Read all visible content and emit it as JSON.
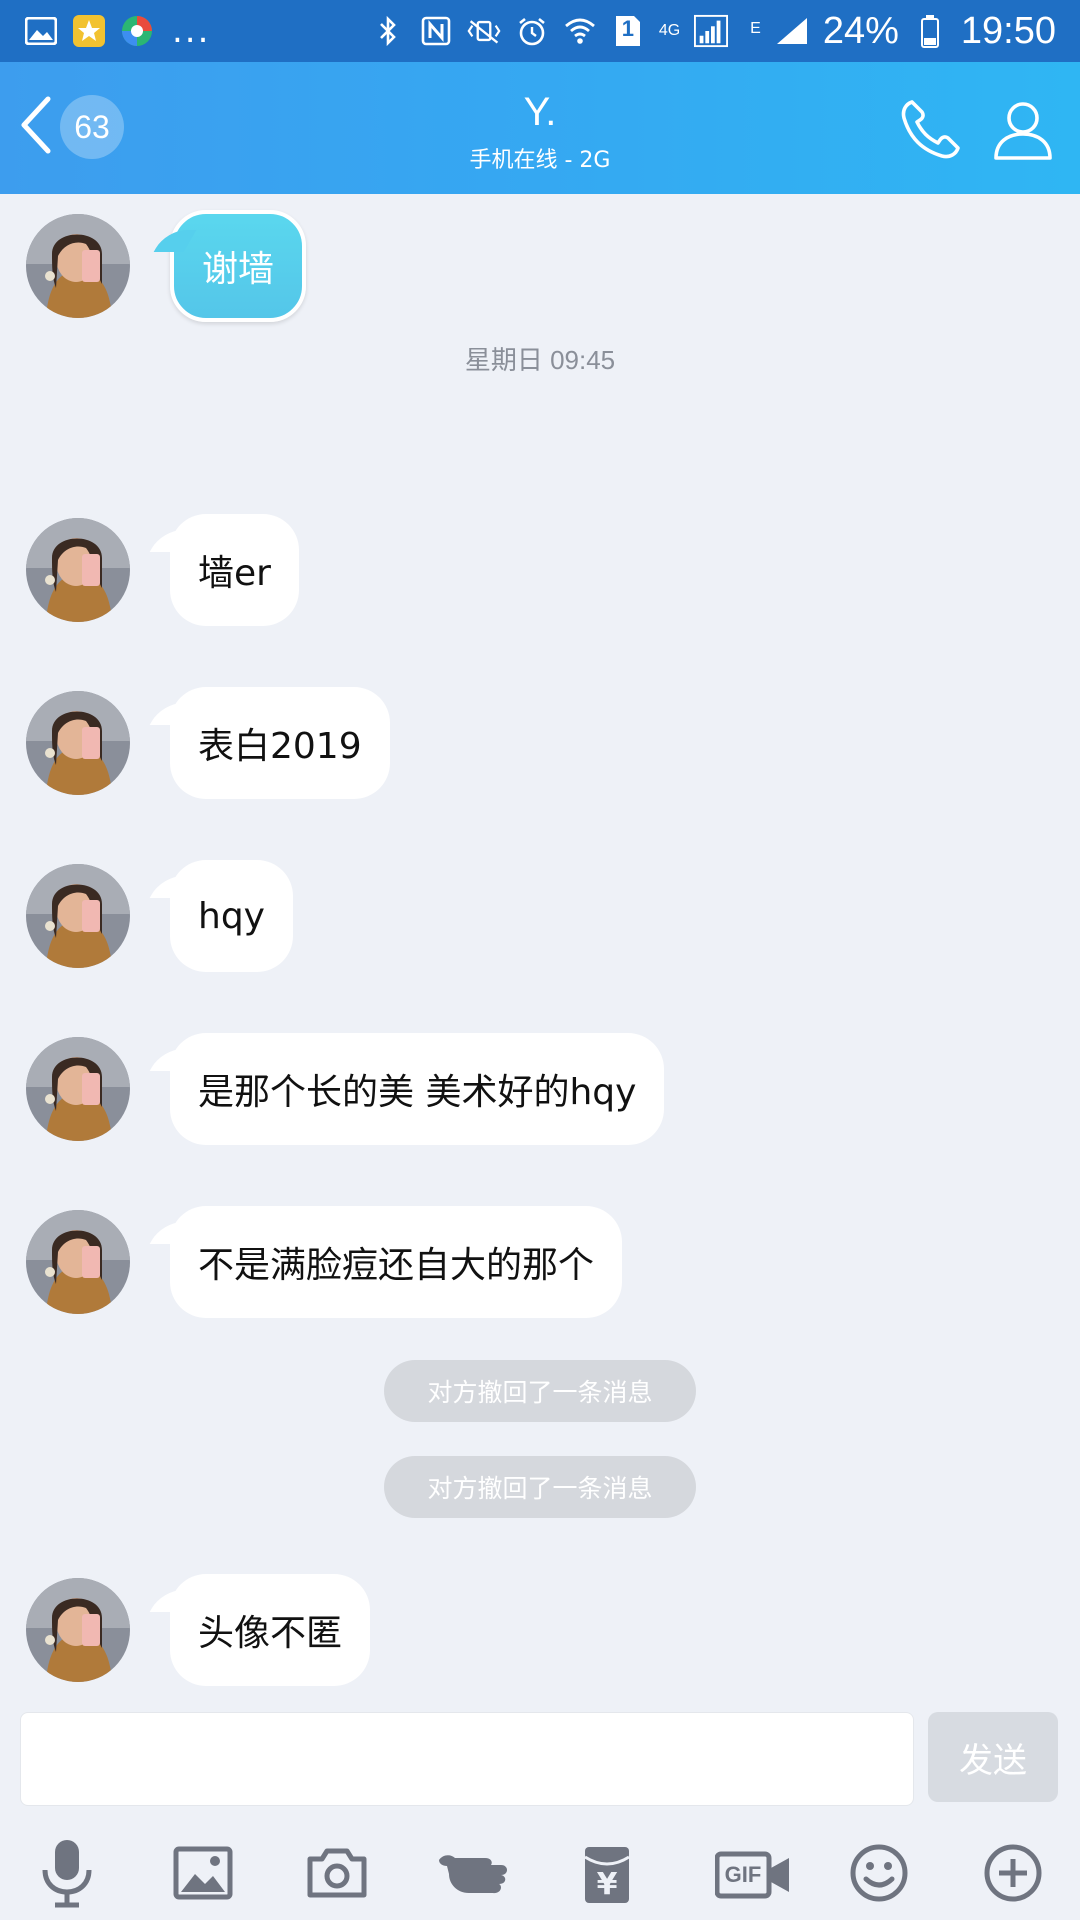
{
  "status_bar": {
    "battery": "24%",
    "time": "19:50",
    "sim_number": "1",
    "network_4g": "4G",
    "network_e": "E",
    "overflow": "..."
  },
  "header": {
    "unread_count": "63",
    "title": "Y.",
    "subtitle": "手机在线 - 2G"
  },
  "messages": [
    {
      "text": "谢墙"
    },
    {
      "timestamp": "星期日 09:45"
    },
    {
      "text": "墙er"
    },
    {
      "text": "表白2019"
    },
    {
      "text": "hqy"
    },
    {
      "text": "是那个长的美 美术好的hqy"
    },
    {
      "text": "不是满脸痘还自大的那个"
    },
    {
      "system": "对方撤回了一条消息"
    },
    {
      "system": "对方撤回了一条消息"
    },
    {
      "text": "头像不匿"
    }
  ],
  "composer": {
    "input_value": "",
    "send_label": "发送"
  },
  "toolbar": {
    "icons": [
      "microphone-icon",
      "image-icon",
      "camera-icon",
      "poke-icon",
      "red-packet-icon",
      "gif-icon",
      "emoji-icon",
      "plus-icon"
    ],
    "red_packet_symbol": "¥",
    "gif_label": "GIF"
  },
  "colors": {
    "status_bar": "#1f6fc4",
    "header_start": "#3d9dee",
    "header_end": "#2fb6f3",
    "chat_bg": "#eef1f7",
    "special_bubble": "#54c6e9",
    "system_pill": "#d5d8dd",
    "toolbar_icon": "#6f7480"
  }
}
